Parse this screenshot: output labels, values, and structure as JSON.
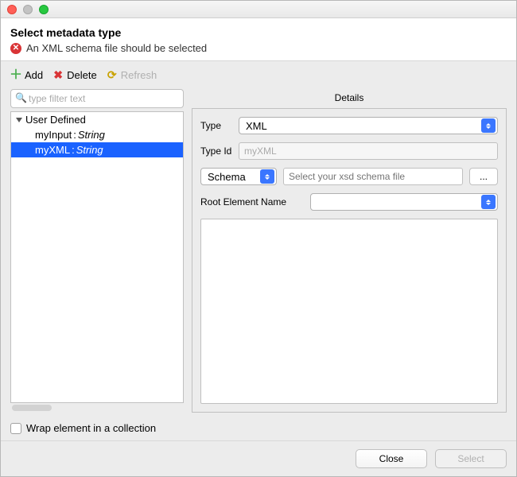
{
  "header": {
    "title": "Select metadata type",
    "error_message": "An XML schema file should be selected"
  },
  "toolbar": {
    "add_label": "Add",
    "delete_label": "Delete",
    "refresh_label": "Refresh"
  },
  "filter": {
    "placeholder": "type filter text"
  },
  "tree": {
    "root_label": "User Defined",
    "items": [
      {
        "name": "myInput",
        "type": "String",
        "selected": false
      },
      {
        "name": "myXML",
        "type": "String",
        "selected": true
      }
    ]
  },
  "details": {
    "title": "Details",
    "type_label": "Type",
    "type_value": "XML",
    "typeid_label": "Type Id",
    "typeid_value": "myXML",
    "schema_label": "Schema",
    "schema_placeholder": "Select your xsd schema file",
    "browse_label": "...",
    "root_element_label": "Root Element Name",
    "root_element_value": ""
  },
  "wrap": {
    "label": "Wrap element in a collection",
    "checked": false
  },
  "footer": {
    "close_label": "Close",
    "select_label": "Select"
  }
}
